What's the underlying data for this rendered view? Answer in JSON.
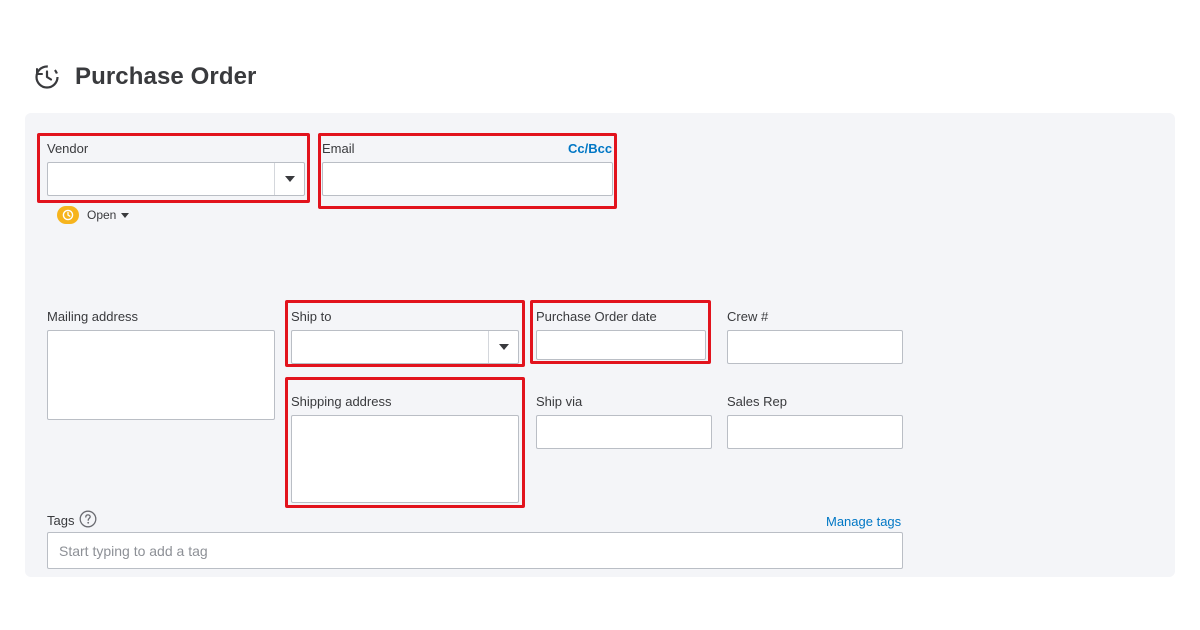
{
  "page": {
    "title": "Purchase Order",
    "title_icon": "purchase-order-clock-icon"
  },
  "form": {
    "vendor": {
      "label": "Vendor",
      "value": ""
    },
    "email": {
      "label": "Email",
      "value": "",
      "cc_bcc_label": "Cc/Bcc"
    },
    "status": {
      "label": "Open",
      "icon": "clock-icon",
      "color": "#f6b41d"
    },
    "mailing_address": {
      "label": "Mailing address",
      "value": ""
    },
    "ship_to": {
      "label": "Ship to",
      "value": ""
    },
    "purchase_order_date": {
      "label": "Purchase Order date",
      "value": ""
    },
    "crew_no": {
      "label": "Crew #",
      "value": ""
    },
    "shipping_address": {
      "label": "Shipping address",
      "value": ""
    },
    "ship_via": {
      "label": "Ship via",
      "value": ""
    },
    "sales_rep": {
      "label": "Sales Rep",
      "value": ""
    },
    "tags": {
      "label": "Tags",
      "help_icon": "question-circle-icon",
      "manage_label": "Manage tags",
      "placeholder": "Start typing to add a tag"
    }
  },
  "colors": {
    "accent_link": "#0077c5",
    "highlight": "#e2131d",
    "panel_bg": "#f4f5f8",
    "status_badge": "#f6b41d"
  }
}
